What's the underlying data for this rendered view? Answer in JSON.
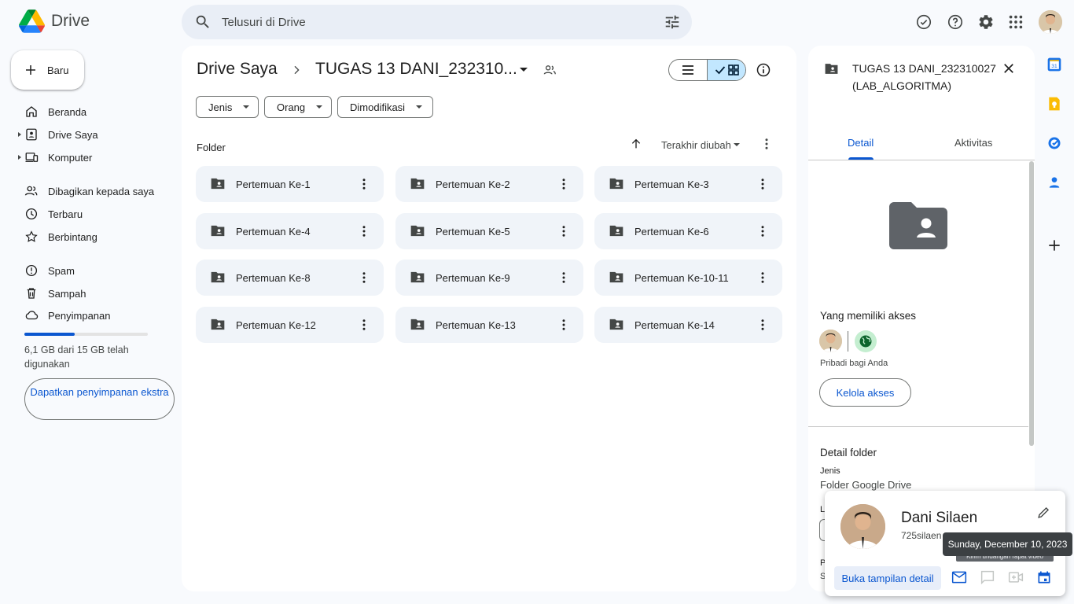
{
  "header": {
    "app_name": "Drive",
    "search_placeholder": "Telusuri di Drive",
    "icons": [
      "search-icon",
      "tune-icon",
      "ready-offline-icon",
      "help-icon",
      "settings-icon",
      "apps-icon",
      "account-avatar"
    ]
  },
  "sidebar": {
    "new_label": "Baru",
    "items": [
      {
        "label": "Beranda",
        "icon": "home-icon"
      },
      {
        "label": "Drive Saya",
        "icon": "my-drive-icon"
      },
      {
        "label": "Komputer",
        "icon": "computer-icon"
      },
      {
        "label": "Dibagikan kepada saya",
        "icon": "shared-icon"
      },
      {
        "label": "Terbaru",
        "icon": "clock-icon"
      },
      {
        "label": "Berbintang",
        "icon": "star-icon"
      },
      {
        "label": "Spam",
        "icon": "spam-icon"
      },
      {
        "label": "Sampah",
        "icon": "trash-icon"
      },
      {
        "label": "Penyimpanan",
        "icon": "cloud-icon"
      }
    ],
    "storage": {
      "used_fraction": 0.41,
      "text": "6,1 GB dari 15 GB telah digunakan",
      "button": "Dapatkan penyimpanan ekstra"
    }
  },
  "main": {
    "breadcrumb_root": "Drive Saya",
    "breadcrumb_current": "TUGAS 13 DANI_232310...",
    "filters": [
      "Jenis",
      "Orang",
      "Dimodifikasi"
    ],
    "section_label": "Folder",
    "sort_label": "Terakhir diubah",
    "folders": [
      "Pertemuan Ke-1",
      "Pertemuan Ke-2",
      "Pertemuan Ke-3",
      "Pertemuan Ke-4",
      "Pertemuan Ke-5",
      "Pertemuan Ke-6",
      "Pertemuan Ke-8",
      "Pertemuan Ke-9",
      "Pertemuan Ke-10-11",
      "Pertemuan Ke-12",
      "Pertemuan Ke-13",
      "Pertemuan Ke-14"
    ]
  },
  "details": {
    "title": "TUGAS 13 DANI_232310027 (LAB_ALGORITMA)",
    "tabs": [
      "Detail",
      "Aktivitas"
    ],
    "access_heading": "Yang memiliki akses",
    "access_note": "Pribadi bagi Anda",
    "manage_access": "Kelola akses",
    "folder_details_heading": "Detail folder",
    "type_label": "Jenis",
    "type_value": "Folder Google Drive",
    "partial_l": "L",
    "partial_p": "P",
    "partial_s": "S"
  },
  "hovercard": {
    "name": "Dani Silaen",
    "email": "725silaen",
    "open_detail": "Buka tampilan detail",
    "tooltip_date": "Sunday, December 10, 2023",
    "tooltip_video": "Kirim undangan rapat video"
  },
  "colors": {
    "accent": "#0b57d0",
    "background": "#f8fafd",
    "card": "#f0f4f9",
    "selected_toggle": "#c2e7ff"
  }
}
